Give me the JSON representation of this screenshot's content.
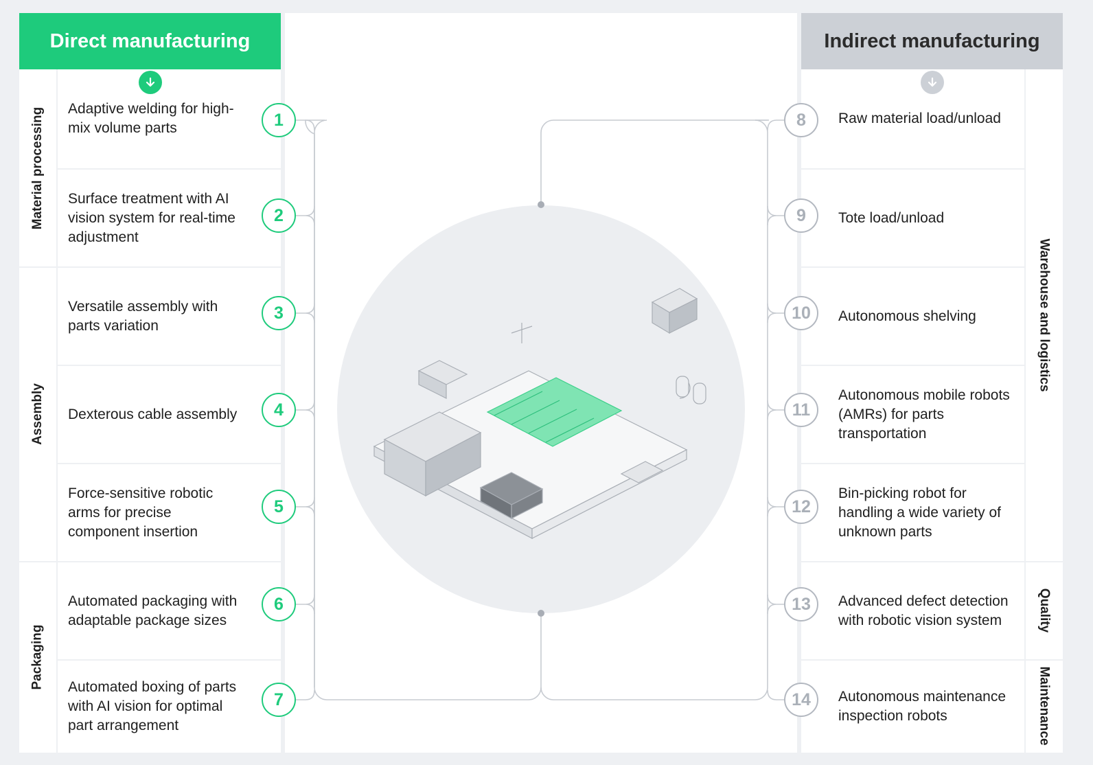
{
  "left_header": "Direct manufacturing",
  "right_header": "Indirect manufacturing",
  "left_categories": [
    "Material processing",
    "Assembly",
    "Packaging"
  ],
  "right_categories": [
    "Warehouse and logistics",
    "Quality",
    "Maintenance"
  ],
  "left_items": [
    {
      "number": "1",
      "text": "Adaptive welding for high-mix volume parts"
    },
    {
      "number": "2",
      "text": "Surface treatment with AI vision system for real-time adjustment"
    },
    {
      "number": "3",
      "text": "Versatile assembly with parts variation"
    },
    {
      "number": "4",
      "text": "Dexterous cable assembly"
    },
    {
      "number": "5",
      "text": "Force-sensitive robotic arms for precise component insertion"
    },
    {
      "number": "6",
      "text": "Automated packaging with adaptable package sizes"
    },
    {
      "number": "7",
      "text": "Automated boxing of parts with AI vision for optimal part arrangement"
    }
  ],
  "right_items": [
    {
      "number": "8",
      "text": "Raw material load/unload"
    },
    {
      "number": "9",
      "text": "Tote load/unload"
    },
    {
      "number": "10",
      "text": "Autonomous shelving"
    },
    {
      "number": "11",
      "text": "Autonomous mobile robots (AMRs) for parts transportation"
    },
    {
      "number": "12",
      "text": "Bin-picking robot for handling a wide variety of unknown parts"
    },
    {
      "number": "13",
      "text": "Advanced defect detection with robotic vision system"
    },
    {
      "number": "14",
      "text": "Autonomous maintenance inspection robots"
    }
  ],
  "colors": {
    "accent_green": "#1ecb7c",
    "indirect_gray": "#ccd0d6",
    "number_gray": "#aab0b8",
    "page_bg": "#eef0f3"
  },
  "icons": [
    "arrow-down-icon",
    "factory-illustration"
  ]
}
